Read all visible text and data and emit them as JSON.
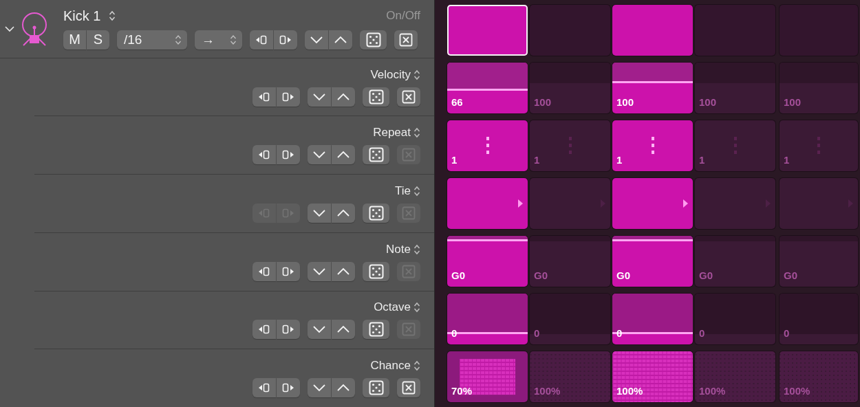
{
  "track": {
    "expanded": true,
    "name": "Kick 1",
    "on_off_label": "On/Off",
    "mute": "M",
    "solo": "S",
    "rate": "/16",
    "direction": "→",
    "shift_enabled": true,
    "clear_enabled": true,
    "steps": [
      {
        "on": true,
        "selected": true
      },
      {
        "on": false,
        "selected": false
      },
      {
        "on": true,
        "selected": false
      },
      {
        "on": false,
        "selected": false
      },
      {
        "on": false,
        "selected": false
      }
    ]
  },
  "lanes": [
    {
      "kind": "velocity",
      "label": "Velocity",
      "shift_enabled": true,
      "clear_enabled": true,
      "steps": [
        {
          "value": "66"
        },
        {
          "value": "100"
        },
        {
          "value": "100"
        },
        {
          "value": "100"
        },
        {
          "value": "100"
        }
      ]
    },
    {
      "kind": "repeat",
      "label": "Repeat",
      "shift_enabled": true,
      "clear_enabled": false,
      "steps": [
        {
          "value": "1"
        },
        {
          "value": "1"
        },
        {
          "value": "1"
        },
        {
          "value": "1"
        },
        {
          "value": "1"
        }
      ]
    },
    {
      "kind": "tie",
      "label": "Tie",
      "shift_enabled": false,
      "clear_enabled": false
    },
    {
      "kind": "note",
      "label": "Note",
      "shift_enabled": true,
      "clear_enabled": false,
      "steps": [
        {
          "value": "G0"
        },
        {
          "value": "G0"
        },
        {
          "value": "G0"
        },
        {
          "value": "G0"
        },
        {
          "value": "G0"
        }
      ]
    },
    {
      "kind": "octave",
      "label": "Octave",
      "shift_enabled": true,
      "clear_enabled": false,
      "steps": [
        {
          "value": "0"
        },
        {
          "value": "0"
        },
        {
          "value": "0"
        },
        {
          "value": "0"
        },
        {
          "value": "0"
        }
      ]
    },
    {
      "kind": "chance",
      "label": "Chance",
      "shift_enabled": true,
      "clear_enabled": true,
      "steps": [
        {
          "value": "70%"
        },
        {
          "value": "100%"
        },
        {
          "value": "100%"
        },
        {
          "value": "100%"
        },
        {
          "value": "100%"
        }
      ]
    }
  ]
}
